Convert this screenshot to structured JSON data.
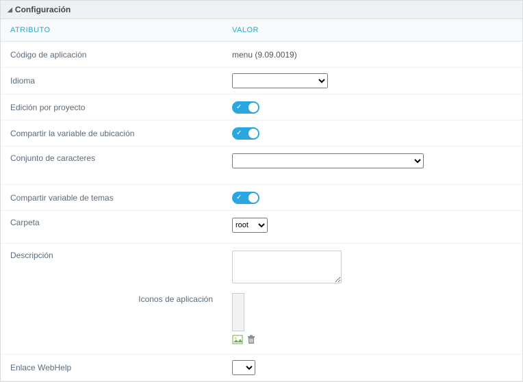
{
  "header": {
    "title": "Configuración"
  },
  "columns": {
    "attr": "ATRIBUTO",
    "val": "VALOR"
  },
  "rows": {
    "appcode": {
      "label": "Código de aplicación",
      "value": "menu (9.09.0019)"
    },
    "idioma": {
      "label": "Idioma",
      "value": ""
    },
    "edicion": {
      "label": "Edición por proyecto",
      "on": true
    },
    "compvar": {
      "label": "Compartir la variable de ubicación",
      "on": true
    },
    "charset": {
      "label": "Conjunto de caracteres",
      "value": ""
    },
    "comptema": {
      "label": "Compartir variable de temas",
      "on": true
    },
    "carpeta": {
      "label": "Carpeta",
      "value": "root",
      "options": [
        "root"
      ]
    },
    "desc": {
      "label": "Descripción",
      "value": ""
    },
    "iconos": {
      "label": "Iconos de aplicación"
    },
    "webhelp": {
      "label": "Enlace WebHelp",
      "value": ""
    }
  }
}
